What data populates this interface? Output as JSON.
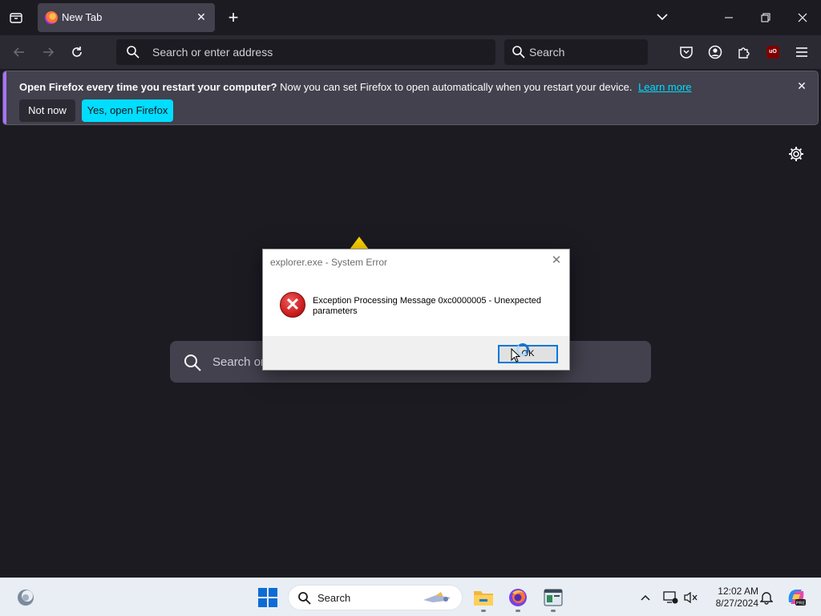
{
  "browser": {
    "tab": {
      "title": "New Tab"
    },
    "urlbar": {
      "placeholder": "Search or enter address"
    },
    "searchbar": {
      "placeholder": "Search"
    },
    "ublock_badge": "uO"
  },
  "notification": {
    "bold_text": "Open Firefox every time you restart your computer?",
    "text": "Now you can set Firefox to open automatically when you restart your device.",
    "link": "Learn more",
    "not_now": "Not now",
    "yes": "Yes, open Firefox"
  },
  "content": {
    "search_placeholder": "Search or"
  },
  "dialog": {
    "title": "explorer.exe - System Error",
    "message": "Exception Processing Message 0xc0000005 - Unexpected parameters",
    "ok": "OK"
  },
  "taskbar": {
    "search_placeholder": "Search",
    "time": "12:02 AM",
    "date": "8/27/2024"
  },
  "colors": {
    "accent": "#00ddff",
    "error_red": "#cc1f1f",
    "windows_blue": "#0f6cd4"
  }
}
